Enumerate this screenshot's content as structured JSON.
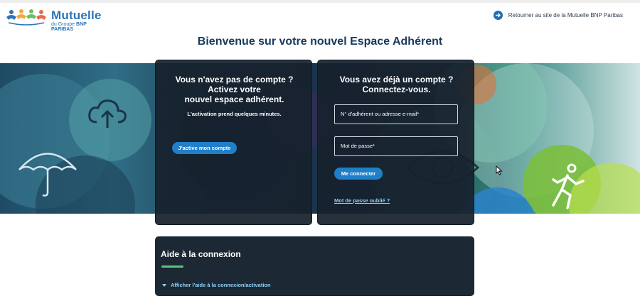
{
  "header": {
    "logo_title": "Mutuelle",
    "logo_sub_prefix": "du Groupe",
    "logo_sub_brand": "BNP PARIBAS",
    "back_link": "Retourner au site de la Mutuelle BNP Paribas"
  },
  "welcome_title": "Bienvenue sur votre nouvel Espace Adhérent",
  "register": {
    "title_line1": "Vous n'avez pas de compte ?",
    "title_line2": "Activez votre",
    "title_line3": "nouvel espace adhérent.",
    "note": "L'activation prend quelques minutes.",
    "button": "J'active mon compte"
  },
  "login": {
    "title_line1": "Vous avez déjà un compte ?",
    "title_line2": "Connectez-vous.",
    "id_placeholder": "N° d'adhérent ou adresse e-mail*",
    "password_placeholder": "Mot de passe*",
    "button": "Me connecter",
    "forgot_link": "Mot de passe oublié ?"
  },
  "help": {
    "title": "Aide à la connexion",
    "toggle_label": "Afficher l'aide à la connexion/activation"
  },
  "colors": {
    "brand_blue": "#2a74b7",
    "button_blue": "#1f7fc9",
    "card_dark": "#17212d",
    "accent_green": "#5fc47e",
    "link_light_blue": "#8fd0f5"
  },
  "icons": [
    "logo-people-icon",
    "arrow-right-circle-icon",
    "cloud-upload-icon",
    "umbrella-icon",
    "eye-icon",
    "running-person-icon",
    "chevron-down-icon",
    "mouse-cursor-icon"
  ]
}
